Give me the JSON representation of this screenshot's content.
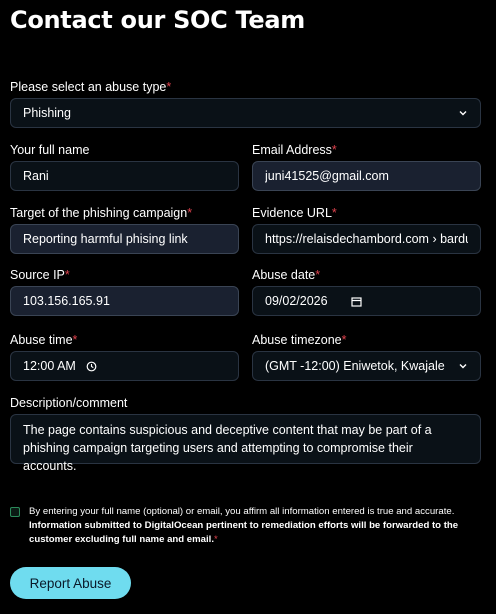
{
  "page_title": "Contact our SOC Team",
  "required_marker": "*",
  "abuse_type": {
    "label": "Please select an abuse type",
    "value": "Phishing"
  },
  "full_name": {
    "label": "Your full name",
    "value": "Rani"
  },
  "email": {
    "label": "Email Address",
    "value": "juni41525@gmail.com"
  },
  "target": {
    "label": "Target of the phishing campaign",
    "value": "Reporting harmful phising link"
  },
  "evidence_url": {
    "label": "Evidence URL",
    "value": "https://relaisdechambord.com › bardur"
  },
  "source_ip": {
    "label": "Source IP",
    "value": "103.156.165.91"
  },
  "abuse_date": {
    "label": "Abuse date",
    "value": "09/02/2026"
  },
  "abuse_time": {
    "label": "Abuse time",
    "value": "12:00 AM"
  },
  "abuse_timezone": {
    "label": "Abuse timezone",
    "value": "(GMT -12:00) Eniwetok, Kwajale"
  },
  "description": {
    "label": "Description/comment",
    "value": "The page contains suspicious and deceptive content that may be part of a phishing campaign targeting users and attempting to compromise their accounts."
  },
  "consent": {
    "text_normal": "By entering your full name (optional) or email, you affirm all information entered is true and accurate.",
    "text_bold": "Information submitted to DigitalOcean pertinent to remediation efforts will be forwarded to the customer excluding full name and email."
  },
  "submit_label": "Report Abuse",
  "colors": {
    "background": "#000000",
    "field_background": "#0a1117",
    "filled_field_background": "#1a2130",
    "required": "#e0434e",
    "button": "#6fdcef"
  }
}
